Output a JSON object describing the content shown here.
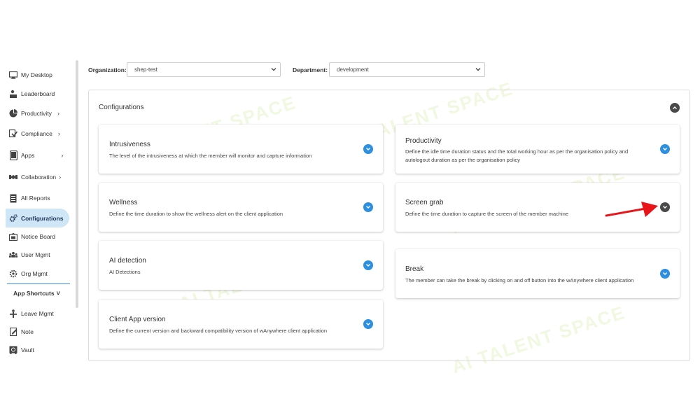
{
  "sidebar": {
    "items": [
      {
        "label": "My Desktop",
        "icon": "monitor-icon"
      },
      {
        "label": "Leaderboard",
        "icon": "leaderboard-icon"
      },
      {
        "label": "Productivity",
        "icon": "pie-chart-icon",
        "chevron": "›"
      },
      {
        "label": "Compliance",
        "icon": "compliance-icon",
        "chevron": "›"
      },
      {
        "label": "Apps",
        "icon": "tablet-icon",
        "chevron": "›"
      },
      {
        "label": "Collaboration",
        "icon": "collaboration-icon",
        "chevron": "›"
      },
      {
        "label": "All Reports",
        "icon": "reports-icon"
      },
      {
        "label": "Configurations",
        "icon": "gears-icon",
        "active": true
      },
      {
        "label": "Notice Board",
        "icon": "notice-board-icon"
      },
      {
        "label": "User Mgmt",
        "icon": "users-icon"
      },
      {
        "label": "Org Mgmt",
        "icon": "org-gear-icon"
      }
    ],
    "shortcuts_heading": "App Shortcuts",
    "shortcuts_chevron": "˅",
    "shortcuts": [
      {
        "label": "Leave Mgmt",
        "icon": "leave-icon"
      },
      {
        "label": "Note",
        "icon": "note-icon"
      },
      {
        "label": "Vault",
        "icon": "vault-icon"
      }
    ]
  },
  "filters": {
    "organization_label": "Organization:",
    "organization_value": "shep-test",
    "department_label": "Department:",
    "department_value": "development"
  },
  "panel": {
    "title": "Configurations",
    "cards": [
      {
        "title": "Intrusiveness",
        "description": "The level of the intrusiveness at which the member will monitor and capture information"
      },
      {
        "title": "Productivity",
        "description": "Define the idle time duration status and the total working hour as per the organisation policy and autologout duration as per the organisation policy"
      },
      {
        "title": "Wellness",
        "description": "Define the time duration to show the wellness alert on the client application"
      },
      {
        "title": "Screen grab",
        "description": "Define the time duration to capture the screen of the member machine"
      },
      {
        "title": "AI detection",
        "description": "AI Detections"
      },
      {
        "title": "Break",
        "description": "The member can take the break by clicking on and off button into the wAnywhere client application"
      },
      {
        "title": "Client App version",
        "description": "Define the current version and backward compatibility version of wAnywhere client application"
      }
    ]
  },
  "colors": {
    "accent_blue": "#2d8fe0",
    "active_nav_bg": "#cfe6f7",
    "annotation_arrow": "#e8151b"
  },
  "watermark_text": "AI TALENT SPACE"
}
